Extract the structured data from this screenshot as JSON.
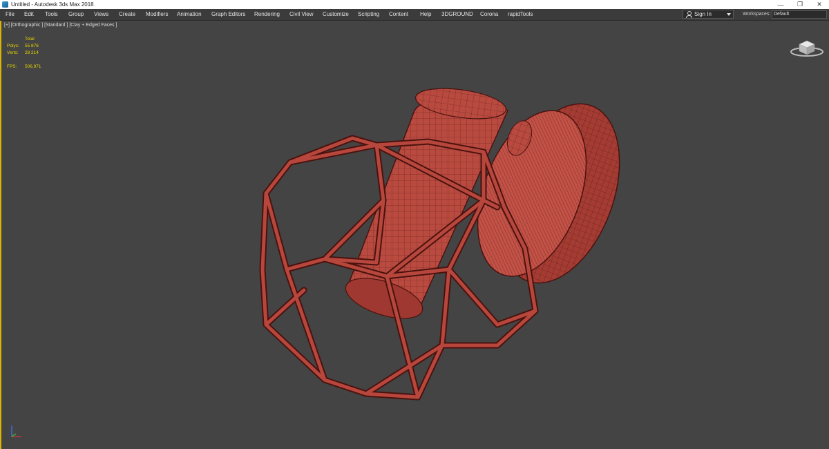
{
  "window": {
    "title": "Untitled - Autodesk 3ds Max 2018",
    "controls": {
      "minimize": "—",
      "maximize": "❐",
      "close": "✕"
    }
  },
  "menu": {
    "items": [
      "File",
      "Edit",
      "Tools",
      "Group",
      "Views",
      "Create",
      "Modifiers",
      "Animation",
      "Graph Editors",
      "Rendering",
      "Civil View",
      "Customize",
      "Scripting",
      "Content",
      "Help",
      "3DGROUND",
      "Corona",
      "rapidTools"
    ],
    "sign_in": "Sign In",
    "workspaces_label": "Workspaces:",
    "workspace_value": "Default"
  },
  "viewport": {
    "label": "[+] [Orthographic ] [Standard ] [Clay + Edged Faces ]",
    "stats": {
      "header": "Total",
      "polys_label": "Polys:",
      "polys_value": "55 876",
      "verts_label": "Verts:",
      "verts_value": "28 214",
      "fps_label": "FPS:",
      "fps_value": "506,971"
    }
  },
  "colors": {
    "clay": "#b8453c",
    "clay_edge": "#5a1712",
    "viewport_bg": "#444444",
    "active_border": "#d9b400",
    "stats_text": "#e8d800"
  },
  "icons": [
    "app-icon",
    "user-icon",
    "chevron-down-icon",
    "viewcube-icon",
    "axis-gizmo-icon"
  ]
}
